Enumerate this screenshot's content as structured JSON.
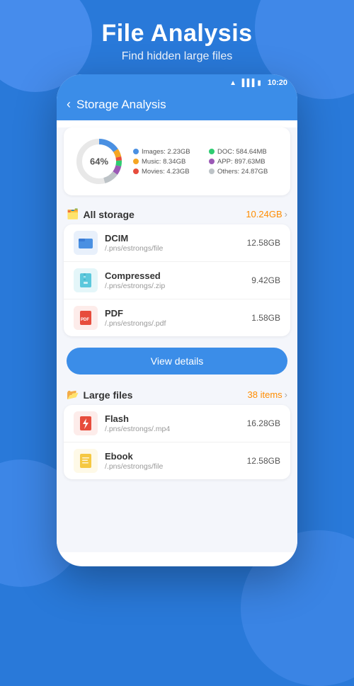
{
  "header": {
    "title": "File Analysis",
    "subtitle": "Find hidden large files"
  },
  "status_bar": {
    "time": "10:20"
  },
  "app_bar": {
    "title": "Storage Analysis"
  },
  "donut": {
    "percent": "64%",
    "segments": [
      {
        "label": "Images",
        "value": "2.23GB",
        "color": "#4a90e2",
        "percent": 22
      },
      {
        "label": "Music",
        "value": "8.34GB",
        "color": "#f5a623",
        "percent": 8
      },
      {
        "label": "Movies",
        "value": "4.23GB",
        "color": "#e74c3c",
        "percent": 4
      },
      {
        "label": "DOC",
        "value": "584.64MB",
        "color": "#2ecc71",
        "percent": 6
      },
      {
        "label": "APP",
        "value": "897.63MB",
        "color": "#9b59b6",
        "percent": 9
      },
      {
        "label": "Others",
        "value": "24.87GB",
        "color": "#95a5a6",
        "percent": 15
      }
    ]
  },
  "all_storage": {
    "label": "All storage",
    "total": "10.24GB",
    "files": [
      {
        "name": "DCIM",
        "path": "/.pns/estrongs/file",
        "size": "12.58GB",
        "icon_color": "#4a90e2",
        "icon": "📁"
      },
      {
        "name": "Compressed",
        "path": "/.pns/estrongs/.zip",
        "size": "9.42GB",
        "icon_color": "#5bc8dc",
        "icon": "🗜"
      },
      {
        "name": "PDF",
        "path": "/.pns/estrongs/.pdf",
        "size": "1.58GB",
        "icon_color": "#e74c3c",
        "icon": "📄"
      }
    ],
    "view_details_label": "View details"
  },
  "large_files": {
    "label": "Large files",
    "count": "38 items",
    "files": [
      {
        "name": "Flash",
        "path": "/.pns/estrongs/.mp4",
        "size": "16.28GB",
        "icon_color": "#e74c3c",
        "icon": "⚡"
      },
      {
        "name": "Ebook",
        "path": "/.pns/estrongs/file",
        "size": "12.58GB",
        "icon_color": "#f5c842",
        "icon": "📒"
      }
    ]
  }
}
